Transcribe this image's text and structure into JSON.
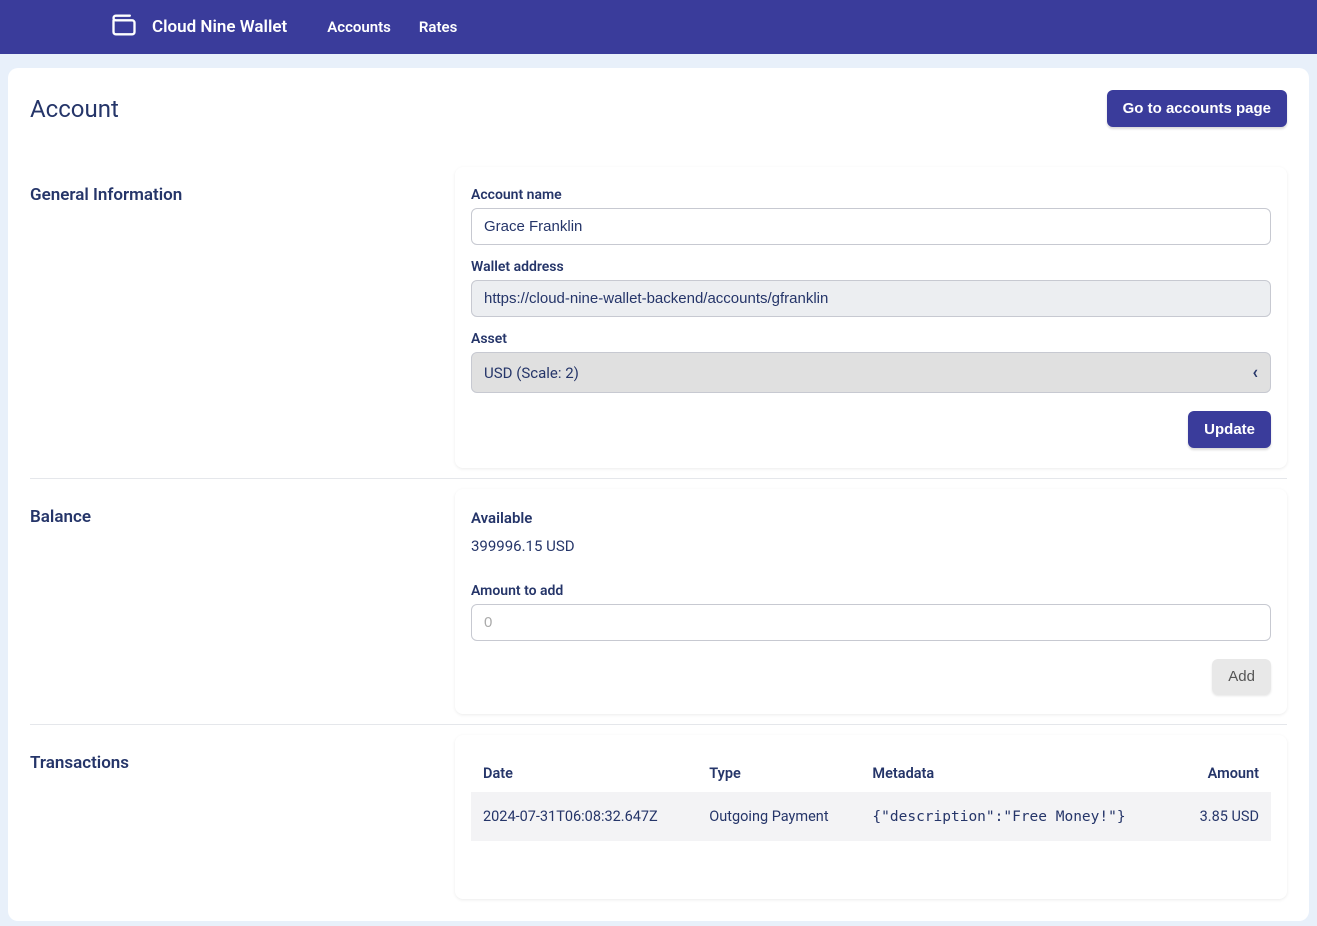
{
  "header": {
    "brand": "Cloud Nine Wallet",
    "nav": {
      "accounts": "Accounts",
      "rates": "Rates"
    }
  },
  "page": {
    "title": "Account",
    "go_accounts_btn": "Go to accounts page"
  },
  "general": {
    "section_title": "General Information",
    "account_name_label": "Account name",
    "account_name_value": "Grace Franklin",
    "wallet_address_label": "Wallet address",
    "wallet_address_value": "https://cloud-nine-wallet-backend/accounts/gfranklin",
    "asset_label": "Asset",
    "asset_value": "USD (Scale: 2)",
    "update_btn": "Update"
  },
  "balance": {
    "section_title": "Balance",
    "available_label": "Available",
    "available_value": "399996.15 USD",
    "amount_to_add_label": "Amount to add",
    "amount_placeholder": "0",
    "add_btn": "Add"
  },
  "transactions": {
    "section_title": "Transactions",
    "columns": {
      "date": "Date",
      "type": "Type",
      "metadata": "Metadata",
      "amount": "Amount"
    },
    "rows": [
      {
        "date": "2024-07-31T06:08:32.647Z",
        "type": "Outgoing Payment",
        "metadata": "{\"description\":\"Free Money!\"}",
        "amount": "3.85 USD"
      }
    ]
  }
}
